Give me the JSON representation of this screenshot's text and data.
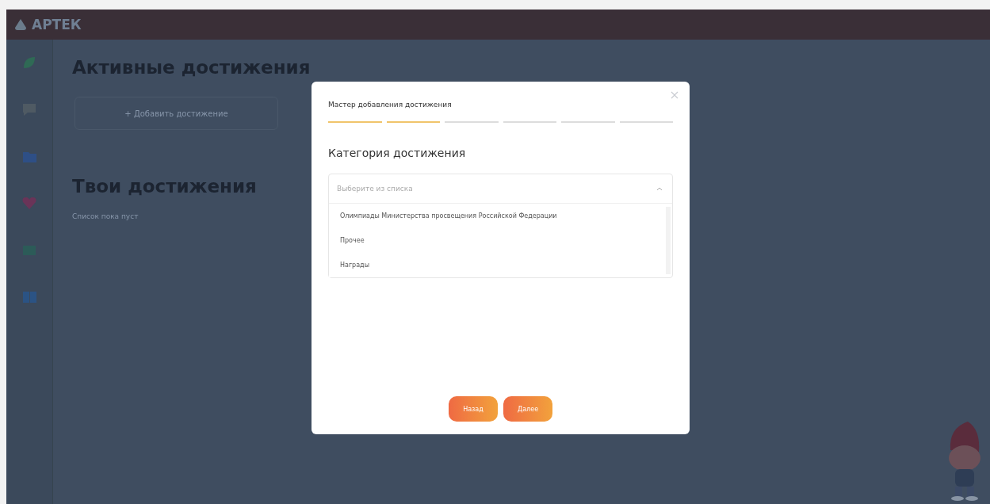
{
  "header": {
    "logo": "АРТЕК"
  },
  "page": {
    "active_title": "Активные достижения",
    "add_button": "+ Добавить достижение",
    "my_title": "Твои достижения",
    "empty_text": "Список пока пуст"
  },
  "dialog": {
    "title": "Мастер добавления достижения",
    "steps": [
      {
        "done": true
      },
      {
        "done": true
      },
      {
        "done": false
      },
      {
        "done": false
      },
      {
        "done": false
      },
      {
        "done": false
      }
    ],
    "heading": "Категория достижения",
    "select": {
      "placeholder": "Выберите из списка",
      "expanded": true,
      "options": [
        "Олимпиады Министерства просвещения Российской Федерации",
        "Прочее",
        "Награды"
      ]
    },
    "buttons": [
      "Назад",
      "Далее"
    ]
  }
}
